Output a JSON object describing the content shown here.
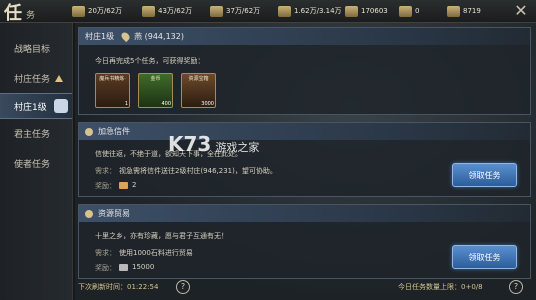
{
  "header": {
    "title_main": "任",
    "title_sub": "务",
    "resources": [
      {
        "icon": "food-icon",
        "value": "20万/62万"
      },
      {
        "icon": "wood-icon",
        "value": "43万/62万"
      },
      {
        "icon": "stone-icon",
        "value": "37万/62万"
      },
      {
        "icon": "iron-icon",
        "value": "1.62万/3.14万"
      },
      {
        "icon": "token-icon",
        "value": "170603"
      },
      {
        "icon": "crown-icon",
        "value": "0"
      },
      {
        "icon": "silver-icon",
        "value": "8719"
      }
    ]
  },
  "sidebar": {
    "items": [
      {
        "label": "战略目标"
      },
      {
        "label": "村庄任务"
      },
      {
        "label": "村庄1级"
      },
      {
        "label": "君主任务"
      },
      {
        "label": "使者任务"
      }
    ]
  },
  "village": {
    "title": "村庄1级",
    "location": "燕 (944,132)",
    "prompt": "今日再完成5个任务，可获得奖励：",
    "rewards": [
      {
        "label": "魔兵书精炼·",
        "count": "1"
      },
      {
        "label": "金币",
        "count": "400"
      },
      {
        "label": "资源宝箱",
        "count": "3000"
      }
    ]
  },
  "tasks": [
    {
      "title": "加急信件",
      "desc": "信使往返，不绝于道，欲知天下事，全在此处。",
      "req_label": "需求：",
      "req": "视急需将信件送往2级村庄(946,231)，望可协助。",
      "reward_label": "奖励：",
      "reward_value": "2",
      "button": "领取任务"
    },
    {
      "title": "资源贸易",
      "desc": "十里之乡，亦有珍藏，愿与君子互通有无！",
      "req_label": "需求：",
      "req": "使用1000石料进行贸易",
      "reward_label": "奖励：",
      "reward_value": "15000",
      "button": "领取任务"
    }
  ],
  "footer": {
    "refresh": "下次刷新时间：01:22:54",
    "daily_limit": "今日任务数量上限：0+0/8",
    "help_glyph": "?"
  },
  "watermark": {
    "main": "K73",
    "sub": "游戏之家"
  }
}
